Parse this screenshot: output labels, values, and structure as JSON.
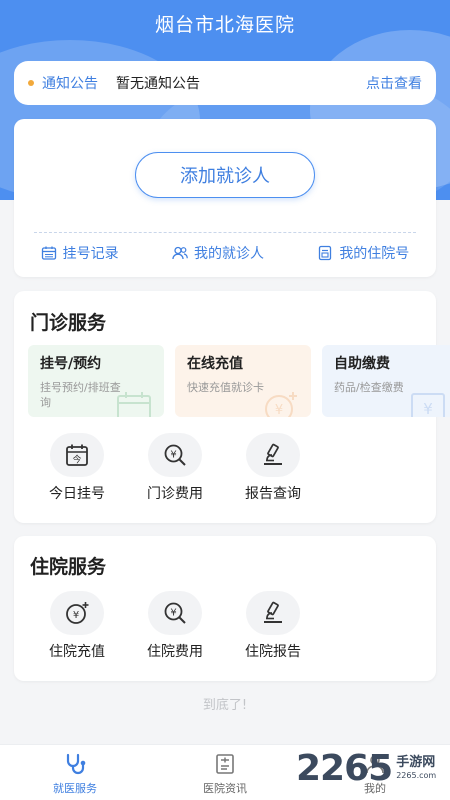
{
  "header": {
    "title": "烟台市北海医院"
  },
  "notice": {
    "label": "通知公告",
    "text": "暂无通知公告",
    "more": "点击查看"
  },
  "patient": {
    "add_label": "添加就诊人",
    "links": [
      {
        "label": "挂号记录",
        "icon": "calendar-icon"
      },
      {
        "label": "我的就诊人",
        "icon": "people-icon"
      },
      {
        "label": "我的住院号",
        "icon": "document-icon"
      }
    ]
  },
  "outpatient": {
    "title": "门诊服务",
    "tiles": [
      {
        "name": "挂号/预约",
        "desc": "挂号预约/排班查询",
        "color": "#eef7f0"
      },
      {
        "name": "在线充值",
        "desc": "快速充值就诊卡",
        "color": "#fdf3ea"
      },
      {
        "name": "自助缴费",
        "desc": "药品/检查缴费",
        "color": "#eef4fc"
      }
    ],
    "icons": [
      {
        "label": "今日挂号",
        "icon": "calendar-today-icon"
      },
      {
        "label": "门诊费用",
        "icon": "fee-search-icon"
      },
      {
        "label": "报告查询",
        "icon": "microscope-icon"
      }
    ]
  },
  "inpatient": {
    "title": "住院服务",
    "icons": [
      {
        "label": "住院充值",
        "icon": "yuan-add-icon"
      },
      {
        "label": "住院费用",
        "icon": "fee-search-icon"
      },
      {
        "label": "住院报告",
        "icon": "microscope-icon"
      }
    ]
  },
  "footer_note": "到底了!",
  "tabbar": {
    "tabs": [
      {
        "label": "就医服务",
        "icon": "stethoscope-icon",
        "active": true
      },
      {
        "label": "医院资讯",
        "icon": "news-icon",
        "active": false
      },
      {
        "label": "我的",
        "icon": "user-icon",
        "active": false
      }
    ]
  },
  "watermark": {
    "number": "2265",
    "text": "手游网",
    "url": "2265.com"
  },
  "colors": {
    "primary": "#4d8ff0",
    "link": "#3f7fe0",
    "notice_dot": "#f2a93b"
  }
}
